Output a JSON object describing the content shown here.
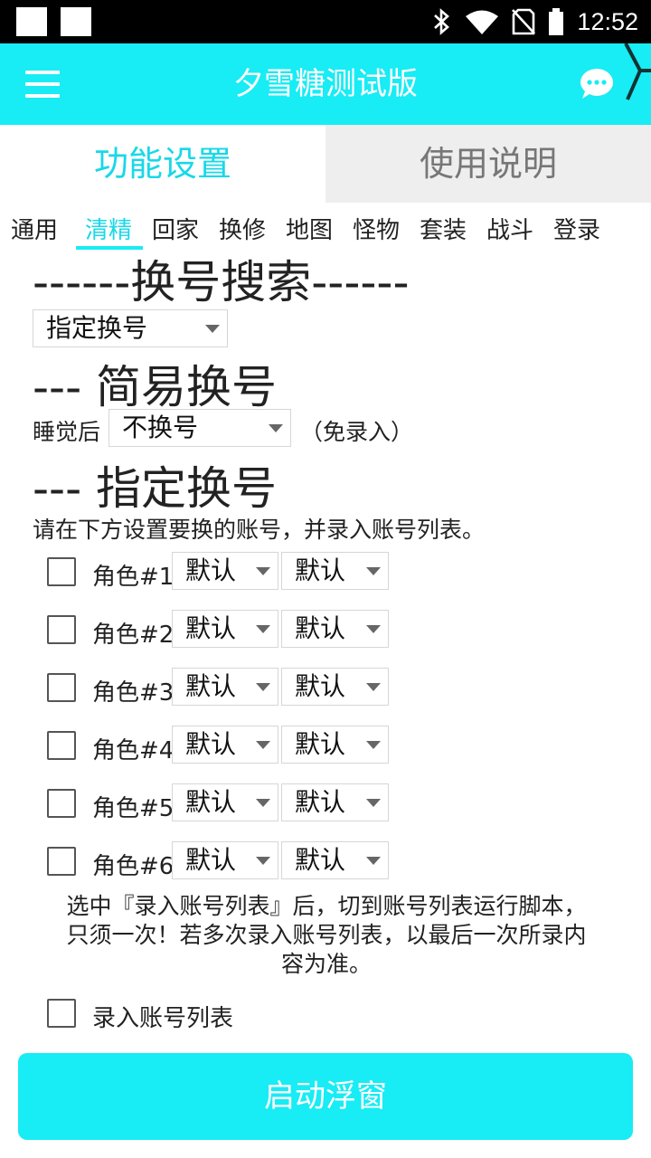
{
  "status_bar": {
    "time": "12:52",
    "icons": [
      "notification-square-icon",
      "notification-square-icon",
      "bluetooth-icon",
      "wifi-icon",
      "no-sim-icon",
      "battery-icon"
    ]
  },
  "app_bar": {
    "title": "夕雪糖测试版",
    "menu_icon": "hamburger-menu-icon",
    "chat_icon": "chat-bubble-icon"
  },
  "top_tabs": [
    {
      "label": "功能设置",
      "selected": true
    },
    {
      "label": "使用说明",
      "selected": false
    }
  ],
  "sub_tabs": [
    {
      "label": "通用",
      "selected": false
    },
    {
      "label": "清精",
      "selected": true
    },
    {
      "label": "回家",
      "selected": false
    },
    {
      "label": "换修",
      "selected": false
    },
    {
      "label": "地图",
      "selected": false
    },
    {
      "label": "怪物",
      "selected": false
    },
    {
      "label": "套装",
      "selected": false
    },
    {
      "label": "战斗",
      "selected": false
    },
    {
      "label": "登录",
      "selected": false
    }
  ],
  "section_title": "------换号搜索------",
  "mode_select": {
    "value": "指定换号"
  },
  "simple_heading": "--- 简易换号",
  "simple_row": {
    "prefix": "睡觉后",
    "select_value": "不换号",
    "suffix": "（免录入）"
  },
  "specified_heading": "--- 指定换号",
  "instruction": "请在下方设置要换的账号，并录入账号列表。",
  "roles": [
    {
      "label": "角色#1",
      "checked": false,
      "select1": "默认",
      "select2": "默认"
    },
    {
      "label": "角色#2",
      "checked": false,
      "select1": "默认",
      "select2": "默认"
    },
    {
      "label": "角色#3",
      "checked": false,
      "select1": "默认",
      "select2": "默认"
    },
    {
      "label": "角色#4",
      "checked": false,
      "select1": "默认",
      "select2": "默认"
    },
    {
      "label": "角色#5",
      "checked": false,
      "select1": "默认",
      "select2": "默认"
    },
    {
      "label": "角色#6",
      "checked": false,
      "select1": "默认",
      "select2": "默认"
    }
  ],
  "note_lines": [
    "选中『录入账号列表』后，切到账号列表运行脚本，",
    "只须一次！若多次录入账号列表，以最后一次所录内",
    "容为准。"
  ],
  "record_list": {
    "label": "录入账号列表",
    "checked": false
  },
  "launch_button": "启动浮窗",
  "colors": {
    "accent": "#18ecf4",
    "accent_text": "#18d8e8",
    "inactive_tab_bg": "#eeeeee"
  }
}
